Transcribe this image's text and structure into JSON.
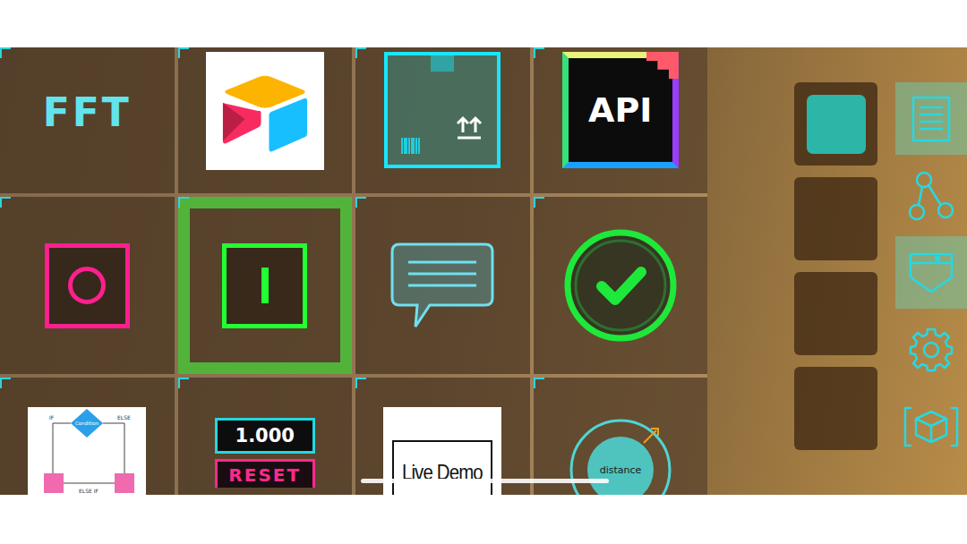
{
  "grid": {
    "tiles": [
      {
        "kind": "text",
        "label": "FFT",
        "selected": false
      },
      {
        "kind": "airtable",
        "selected": false
      },
      {
        "kind": "package",
        "selected": false
      },
      {
        "kind": "api",
        "label": "API",
        "selected": false
      },
      {
        "kind": "circle-toggle",
        "selected": false
      },
      {
        "kind": "bar-toggle",
        "selected": true
      },
      {
        "kind": "chat",
        "selected": false
      },
      {
        "kind": "check",
        "selected": false
      },
      {
        "kind": "flowchart",
        "labels": [
          "IF",
          "Condition",
          "ELSE",
          "ELSE IF"
        ],
        "selected": false
      },
      {
        "kind": "counter",
        "value": "1.000",
        "button": "RESET",
        "selected": false
      },
      {
        "kind": "live-demo",
        "label": "Live Demo",
        "selected": false
      },
      {
        "kind": "distance",
        "label": "distance",
        "selected": false
      }
    ]
  },
  "slots": [
    {
      "filled": true
    },
    {
      "filled": false
    },
    {
      "filled": false
    },
    {
      "filled": false
    }
  ],
  "toolbar": [
    {
      "kind": "document",
      "selected": true
    },
    {
      "kind": "share",
      "selected": false
    },
    {
      "kind": "pocket",
      "selected": true
    },
    {
      "kind": "settings",
      "selected": false
    },
    {
      "kind": "ar-box",
      "selected": false
    }
  ]
}
